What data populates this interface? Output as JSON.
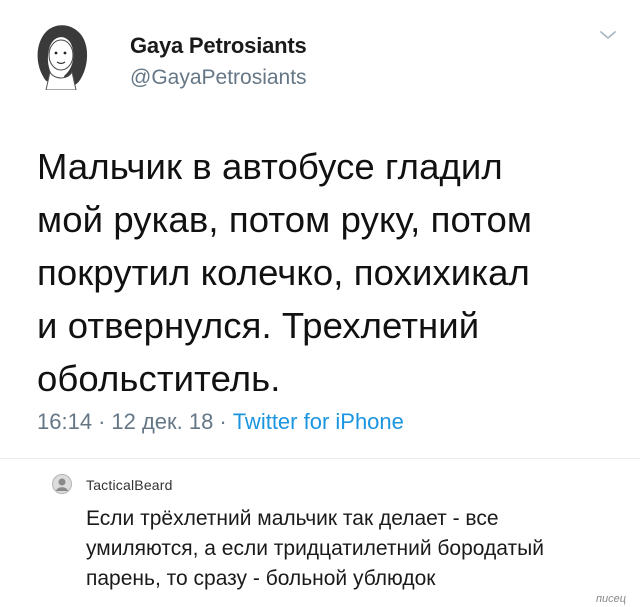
{
  "tweet": {
    "author_name": "Gaya Petrosiants",
    "author_handle": "@GayaPetrosiants",
    "text_lines": [
      "Мальчик в автобусе гладил",
      "мой рукав, потом руку, потом",
      "покрутил колечко, похихикал",
      "и отвернулся. Трехлетний",
      "обольститель."
    ],
    "time": "16:14",
    "date": "12 дек. 18",
    "separator": "·",
    "source": "Twitter for iPhone"
  },
  "reply": {
    "username": "TacticalBeard",
    "text_lines": [
      "Если трёхлетний мальчик так делает - все",
      "умиляются,  а если тридцатилетний бородатый",
      "парень, то сразу -  больной ублюдок"
    ]
  },
  "watermark": "писец",
  "icons": {
    "author_avatar": "avatar-sketch-icon",
    "menu": "chevron-down-icon",
    "reply_avatar": "avatar-icon"
  },
  "colors": {
    "handle": "#657786",
    "source_link": "#1b95e0",
    "text": "#111111"
  }
}
